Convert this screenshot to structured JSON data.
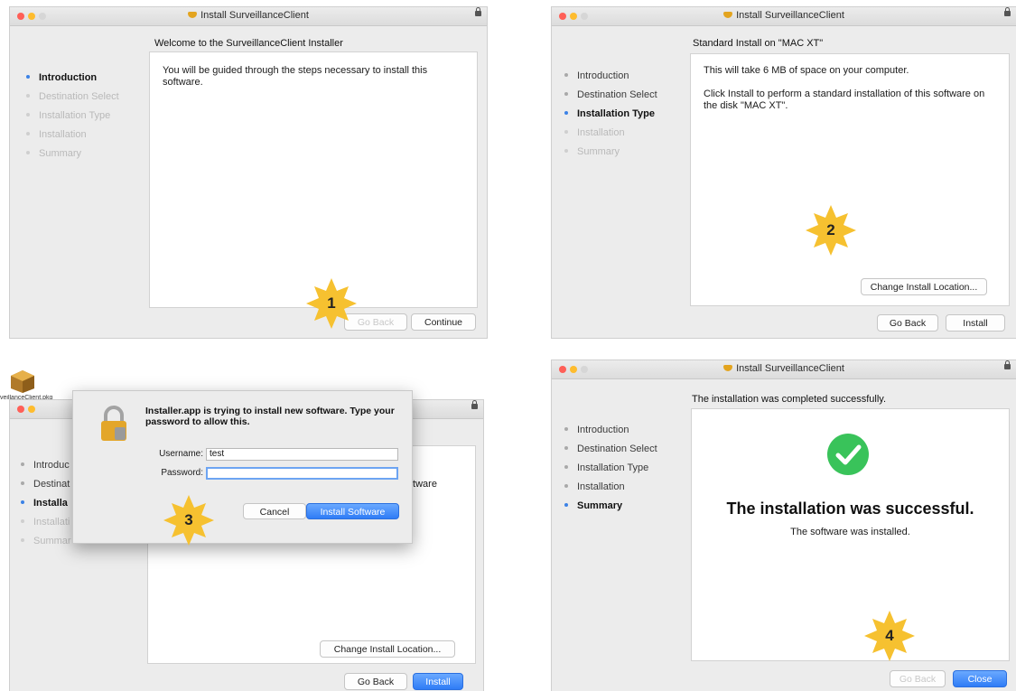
{
  "window_title": "Install SurveillanceClient",
  "steps": [
    "Introduction",
    "Destination Select",
    "Installation Type",
    "Installation",
    "Summary"
  ],
  "panel1": {
    "heading": "Welcome to the SurveillanceClient Installer",
    "body": "You will be guided through the steps necessary to install this software.",
    "go_back": "Go Back",
    "continue": "Continue",
    "badge": "1"
  },
  "panel2": {
    "heading": "Standard Install on \"MAC XT\"",
    "line1": "This will take 6 MB of space on your computer.",
    "line2": "Click Install to perform a standard installation of this software on the disk \"MAC XT\".",
    "change_location": "Change Install Location...",
    "go_back": "Go Back",
    "install": "Install",
    "badge": "2"
  },
  "panel3": {
    "icon_caption": "veillanceClient.pkg",
    "dialog_title": "Installer.app is trying to install new software. Type your password to allow this.",
    "username_label": "Username:",
    "username_value": "test",
    "password_label": "Password:",
    "cancel": "Cancel",
    "install_software": "Install Software",
    "bg_text": "ftware",
    "change_location": "Change Install Location...",
    "go_back": "Go Back",
    "install": "Install",
    "badge": "3",
    "steps_clipped": [
      "Introduc",
      "Destinat",
      "Installa",
      "Installati",
      "Summar"
    ]
  },
  "panel4": {
    "heading": "The installation was completed successfully.",
    "big": "The installation was successful.",
    "sub": "The software was installed.",
    "go_back": "Go Back",
    "close": "Close",
    "badge": "4"
  },
  "colors": {
    "accent": "#3b82e6",
    "badge": "#f6c130",
    "success": "#39c35a"
  }
}
